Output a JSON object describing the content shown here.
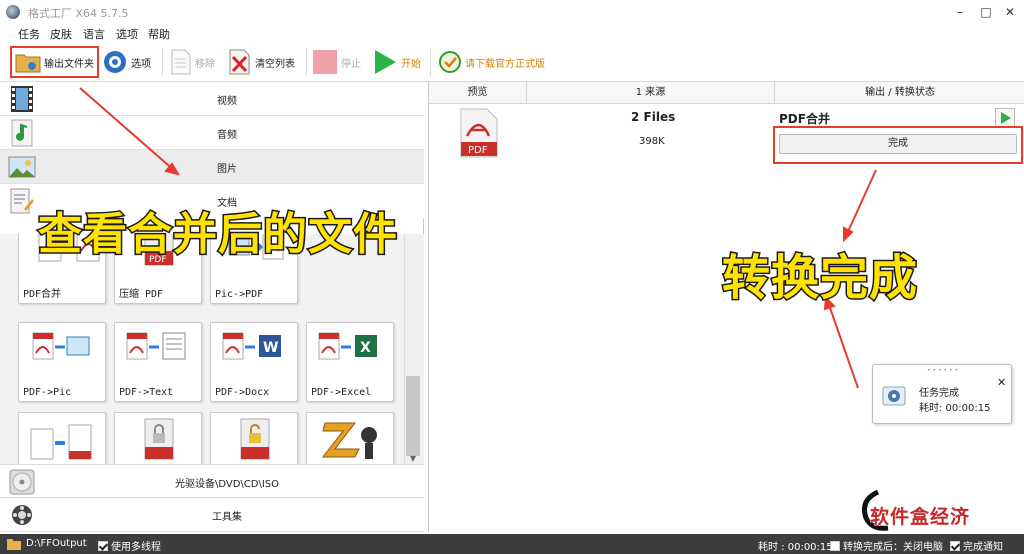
{
  "window": {
    "title": "格式工厂 X64 5.7.5"
  },
  "menu": {
    "items": [
      "任务",
      "皮肤",
      "语言",
      "选项",
      "帮助"
    ]
  },
  "toolbar": {
    "output_folder": "输出文件夹",
    "options": "选项",
    "remove": "移除",
    "clear_list": "清空列表",
    "stop": "停止",
    "start": "开始",
    "download": "请下载官方正式版"
  },
  "categories": {
    "video": "视频",
    "audio": "音频",
    "image": "图片",
    "document": "文档",
    "disc": "光驱设备\\DVD\\CD\\ISO",
    "toolbox": "工具集"
  },
  "tiles": [
    "PDF合并",
    "压缩 PDF",
    "Pic->PDF",
    "PDF->Pic",
    "PDF->Text",
    "PDF->Docx",
    "PDF->Excel",
    "",
    "",
    ""
  ],
  "table": {
    "headers": [
      "预览",
      "1 来源",
      "输出 / 转换状态"
    ],
    "row": {
      "source_name": "2 Files",
      "source_size": "398K",
      "output_name": "PDF合并",
      "status": "完成"
    }
  },
  "notification": {
    "title": "任务完成",
    "time": "耗时: 00:00:15"
  },
  "statusbar": {
    "output_path": "D:\\FFOutput",
    "multithread": "使用多线程",
    "elapsed": "耗时 : 00:00:15",
    "shutdown": "转换完成后：关闭电脑",
    "notify": "完成通知"
  },
  "annotations": {
    "view_merged": "查看合并后的文件",
    "convert_done": "转换完成"
  },
  "watermark": {
    "text": "软件盒经济"
  },
  "colors": {
    "annotation_red": "#e53c2c",
    "annotation_yellow": "#ffe200",
    "pdf_red": "#c9302c",
    "start_green": "#28b446"
  }
}
